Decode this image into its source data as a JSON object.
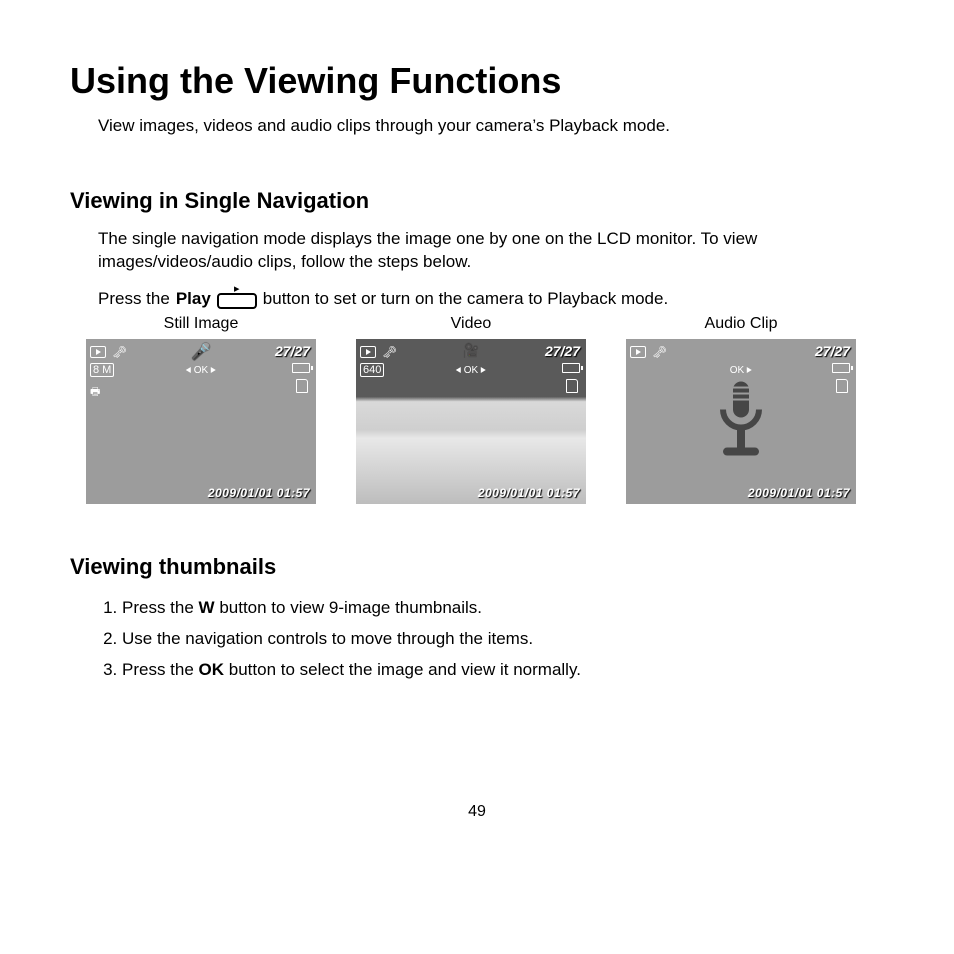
{
  "title": "Using the Viewing Functions",
  "intro": "View images, videos and audio clips through your camera’s Playback mode.",
  "section1": {
    "heading": "Viewing in Single Navigation",
    "body": "The single navigation mode displays the image one by one on the LCD monitor. To view images/videos/audio clips, follow the steps below.",
    "press_prefix": "Press the ",
    "press_bold": "Play",
    "press_suffix": " button to set or turn on the camera to Playback mode.",
    "columns": {
      "still": "Still Image",
      "video": "Video",
      "audio": "Audio Clip"
    },
    "lcd": {
      "counter": "27/27",
      "timestamp": "2009/01/01  01:57",
      "still_left_stack": {
        "megapixel": "8 M",
        "printer": "🖶"
      },
      "video_left": "640",
      "ok_label": "OK"
    }
  },
  "section2": {
    "heading": "Viewing thumbnails",
    "steps": [
      {
        "pre": "Press the ",
        "bold": "W",
        "post": " button to view 9-image thumbnails."
      },
      {
        "pre": "Use the navigation controls to move through the items.",
        "bold": "",
        "post": ""
      },
      {
        "pre": "Press the ",
        "bold": "OK",
        "post": " button to select the image and view it normally."
      }
    ]
  },
  "page_number": "49"
}
